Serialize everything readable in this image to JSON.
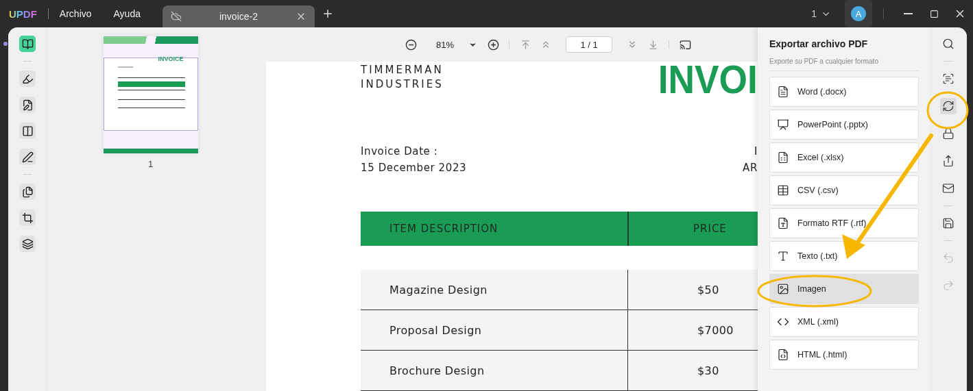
{
  "title_bar": {
    "logo": "UPDF",
    "menu": [
      "Archivo",
      "Ayuda"
    ],
    "tabs": [
      {
        "label": "invoice-2",
        "selected": true
      }
    ],
    "page_count": "1",
    "avatar": "A"
  },
  "left_tool_groups": [
    {
      "tools": [
        {
          "kind": "reader",
          "selected": true
        }
      ]
    },
    {
      "tools": [
        {
          "kind": "comment",
          "selected": false
        },
        {
          "kind": "edit",
          "selected": false
        },
        {
          "kind": "form",
          "selected": false
        },
        {
          "kind": "sign",
          "selected": false
        }
      ]
    },
    {
      "tools": [
        {
          "kind": "pages",
          "selected": false
        },
        {
          "kind": "crop",
          "selected": false
        },
        {
          "kind": "layers",
          "selected": false
        }
      ]
    }
  ],
  "thumbnails": [
    {
      "title": "INVOICE",
      "page": "1"
    }
  ],
  "toolbar": {
    "zoom": "81%",
    "page": "1 / 1"
  },
  "document": {
    "company": [
      "TIMMERMAN",
      "INDUSTRIES"
    ],
    "title": "INVOI",
    "date_label": "Invoice Date :",
    "date": "15 December 2023",
    "right_label": "I",
    "right_value": "AR",
    "columns": [
      "ITEM DESCRIPTION",
      "PRICE"
    ],
    "rows": [
      [
        "Magazine Design",
        "$50"
      ],
      [
        "Proposal Design",
        "$7000"
      ],
      [
        "Brochure Design",
        "$30"
      ]
    ]
  },
  "export_panel": {
    "title": "Exportar archivo PDF",
    "subtitle": "Exporte su PDF a cualquier formato",
    "formats": [
      {
        "kind": "word",
        "label": "Word (.docx)",
        "selected": false
      },
      {
        "kind": "powerpoint",
        "label": "PowerPoint (.pptx)",
        "selected": false
      },
      {
        "kind": "excel",
        "label": "Excel (.xlsx)",
        "selected": false
      },
      {
        "kind": "csv",
        "label": "CSV (.csv)",
        "selected": false
      },
      {
        "kind": "rtf",
        "label": "Formato RTF (.rtf)",
        "selected": false
      },
      {
        "kind": "text",
        "label": "Texto (.txt)",
        "selected": false
      },
      {
        "kind": "image",
        "label": "Imagen",
        "selected": true
      },
      {
        "kind": "xml",
        "label": "XML (.xml)",
        "selected": false
      },
      {
        "kind": "html",
        "label": "HTML (.html)",
        "selected": false
      }
    ]
  },
  "right_tool_groups": [
    {
      "tools": [
        {
          "kind": "search",
          "selected": false,
          "disabled": false
        }
      ]
    },
    {
      "tools": [
        {
          "kind": "ocr",
          "selected": false,
          "disabled": false
        },
        {
          "kind": "convert",
          "selected": true,
          "disabled": false
        },
        {
          "kind": "protect",
          "selected": false,
          "disabled": false
        },
        {
          "kind": "share",
          "selected": false,
          "disabled": false
        },
        {
          "kind": "email",
          "selected": false,
          "disabled": false
        }
      ]
    },
    {
      "tools": [
        {
          "kind": "save",
          "selected": false,
          "disabled": false
        }
      ]
    },
    {
      "tools": [
        {
          "kind": "undo",
          "selected": false,
          "disabled": true
        },
        {
          "kind": "redo",
          "selected": false,
          "disabled": true
        }
      ]
    }
  ]
}
